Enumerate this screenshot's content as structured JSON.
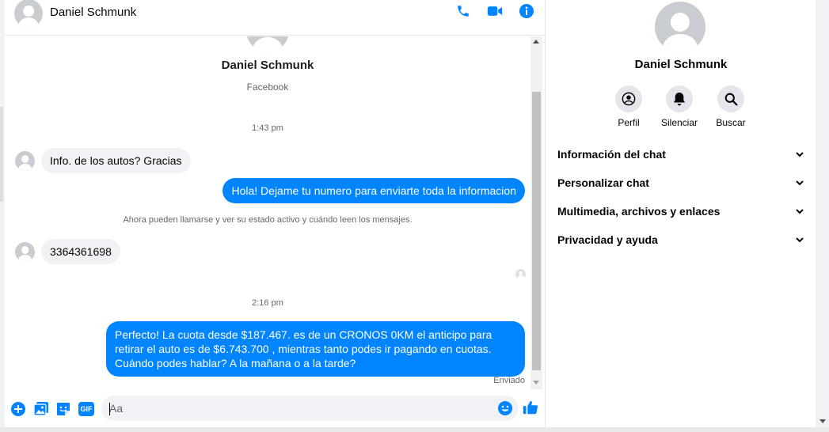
{
  "contact": {
    "name": "Daniel Schmunk",
    "source": "Facebook"
  },
  "header": {
    "name": "Daniel Schmunk",
    "icons": [
      "phone-icon",
      "video-icon",
      "info-icon"
    ]
  },
  "messages": {
    "time1": "1:43 pm",
    "msg1": "Info. de los autos? Gracias",
    "msg2": "Hola! Dejame tu numero  para enviarte toda la informacion",
    "notice": "Ahora pueden llamarse y ver su estado activo y cuándo leen los mensajes.",
    "msg3": "3364361698",
    "time2": "2:16 pm",
    "msg4": "Perfecto! La cuota desde $187.467. es de un CRONOS 0KM el anticipo para retirar el auto es de $6.743.700 , mientras tanto podes ir pagando en cuotas. Cuándo podes hablar? A la mañana o a la tarde?",
    "status": "Enviado"
  },
  "composer": {
    "placeholder": "Aa",
    "icons": [
      "plus-icon",
      "image-icon",
      "sticker-icon",
      "gif-icon",
      "emoji-icon",
      "thumbs-up-icon"
    ],
    "gif_label": "GIF"
  },
  "info_panel": {
    "name": "Daniel Schmunk",
    "actions": [
      {
        "label": "Perfil",
        "icon": "profile-icon"
      },
      {
        "label": "Silenciar",
        "icon": "bell-icon"
      },
      {
        "label": "Buscar",
        "icon": "search-icon"
      }
    ],
    "sections": [
      {
        "label": "Información del chat"
      },
      {
        "label": "Personalizar chat"
      },
      {
        "label": "Multimedia, archivos y enlaces"
      },
      {
        "label": "Privacidad y ayuda"
      }
    ]
  },
  "colors": {
    "accent": "#0084ff",
    "bubble_in": "#f0f2f5",
    "muted_text": "#65676b"
  }
}
